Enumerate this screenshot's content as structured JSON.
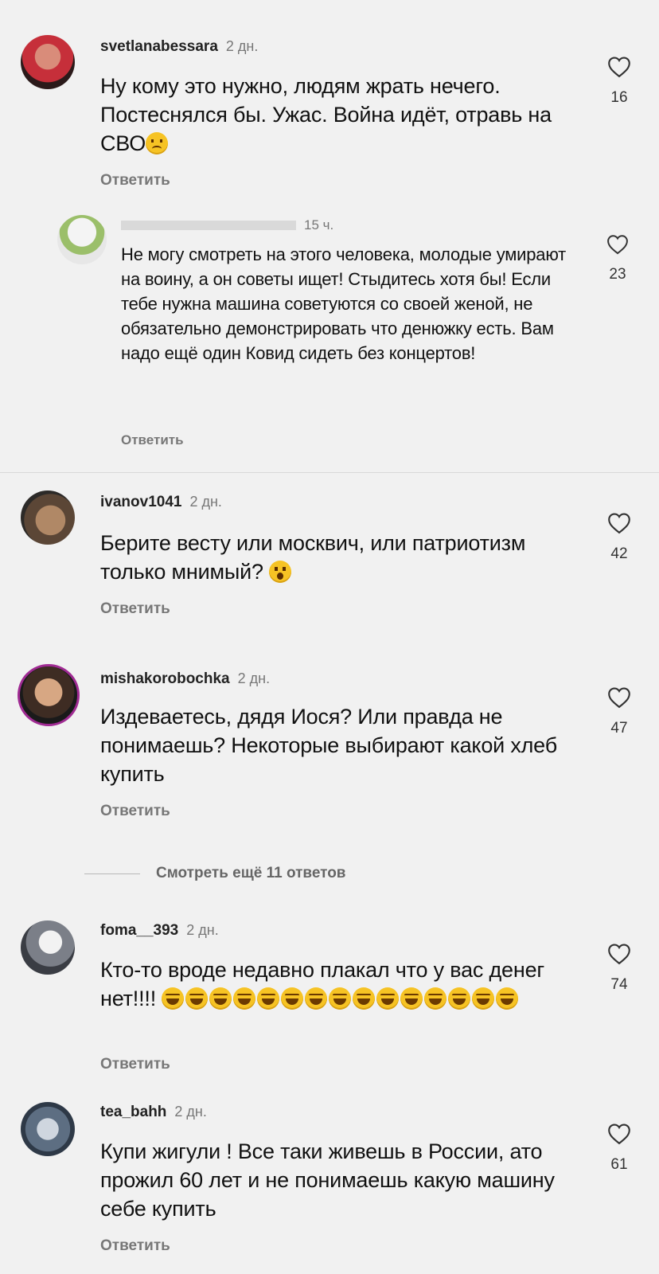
{
  "reply_label": "Ответить",
  "view_more": "Смотреть ещё 11 ответов",
  "comments": [
    {
      "username": "svetlanabessara",
      "time": "2 дн.",
      "text": "Ну кому это нужно, людям жрать нечего. Постеснялся бы. Ужас. Война идёт, отравь на СВО",
      "likes": "16"
    },
    {
      "username": "",
      "time": "15 ч.",
      "text": "Не могу смотреть на этого человека, молодые умирают на воину, а он советы ищет! Стыдитесь хотя бы! Если тебе нужна машина советуются со своей женой, не обязательно демонстрировать что денюжку есть. Вам надо ещё один Ковид сидеть без концертов!",
      "likes": "23"
    },
    {
      "username": "ivanov1041",
      "time": "2 дн.",
      "text": "Берите весту или москвич, или патриотизм только мнимый?",
      "likes": "42"
    },
    {
      "username": "mishakorobochka",
      "time": "2 дн.",
      "text": "Издеваетесь, дядя Иося? Или правда не понимаешь? Некоторые выбирают какой хлеб купить",
      "likes": "47"
    },
    {
      "username": "foma__393",
      "time": "2 дн.",
      "text": "Кто-то вроде недавно плакал что у вас денег нет!!!!",
      "likes": "74"
    },
    {
      "username": "tea_bahh",
      "time": "2 дн.",
      "text": "Купи жигули ! Все таки живешь в России, ато прожил 60 лет и не понимаешь какую машину себе купить",
      "likes": "61"
    }
  ]
}
